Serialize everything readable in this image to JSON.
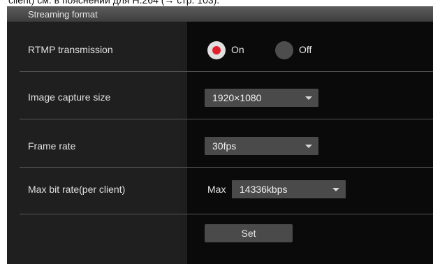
{
  "top_text": "client) см. в пояснении для H.264 (→ стр. 103).",
  "section": {
    "title": "Streaming format"
  },
  "rows": {
    "rtmp": {
      "label": "RTMP transmission",
      "options": [
        "On",
        "Off"
      ],
      "selected": "On"
    },
    "image_capture_size": {
      "label": "Image capture size",
      "value": "1920×1080"
    },
    "frame_rate": {
      "label": "Frame rate",
      "value": "30fps"
    },
    "max_bit_rate": {
      "label": "Max bit rate(per client)",
      "prefix": "Max",
      "value": "14336kbps"
    }
  },
  "set_button": {
    "label": "Set"
  },
  "colors": {
    "selected_radio_dot": "#e0202a",
    "panel_background": "#1e1e1e",
    "control_background": "#4a4a4a"
  }
}
